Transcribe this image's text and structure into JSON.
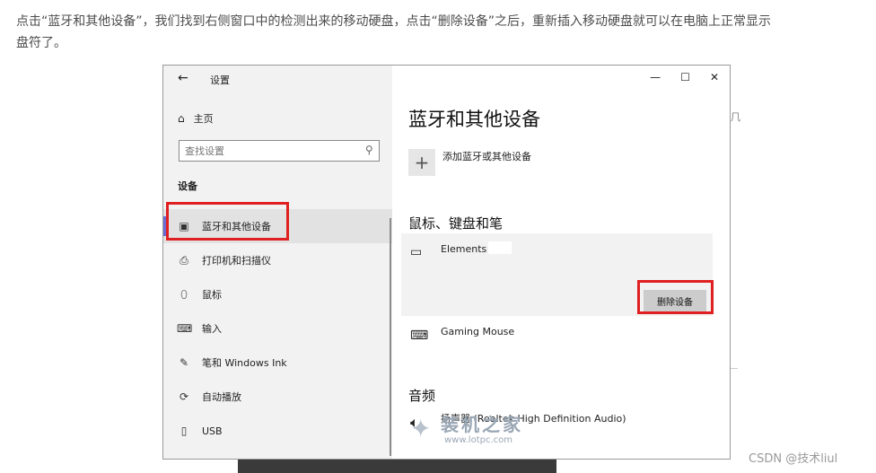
{
  "article": {
    "line1": "点击“蓝牙和其他设备”，我们找到右侧窗口中的检测出来的移动硬盘，点击“删除设备”之后，重新插入移动硬盘就可以在电脑上正常显示",
    "line2": "盘符了。"
  },
  "window": {
    "back_glyph": "←",
    "title": "设置",
    "controls": {
      "minimize": "—",
      "maximize": "☐",
      "close": "✕"
    }
  },
  "sidebar": {
    "home_label": "主页",
    "search_placeholder": "查找设置",
    "section_label": "设备",
    "items": [
      {
        "label": "蓝牙和其他设备",
        "icon": "bluetooth-devices-icon",
        "glyph": "▣",
        "active": true
      },
      {
        "label": "打印机和扫描仪",
        "icon": "printer-icon",
        "glyph": "⎙",
        "active": false
      },
      {
        "label": "鼠标",
        "icon": "mouse-icon",
        "glyph": "⬯",
        "active": false
      },
      {
        "label": "输入",
        "icon": "keyboard-icon",
        "glyph": "⌨",
        "active": false
      },
      {
        "label": "笔和 Windows Ink",
        "icon": "pen-icon",
        "glyph": "✎",
        "active": false
      },
      {
        "label": "自动播放",
        "icon": "autoplay-icon",
        "glyph": "⟳",
        "active": false
      },
      {
        "label": "USB",
        "icon": "usb-icon",
        "glyph": "▯",
        "active": false
      }
    ]
  },
  "main": {
    "heading": "蓝牙和其他设备",
    "add_device_label": "添加蓝牙或其他设备",
    "add_glyph": "+",
    "mouse_keyboard_heading": "鼠标、键盘和笔",
    "devices": [
      {
        "name": "Elements .",
        "icon": "drive-icon",
        "glyph": "▭"
      },
      {
        "name": "Gaming Mouse",
        "icon": "keyboard-device-icon",
        "glyph": "⌨"
      }
    ],
    "remove_button": "删除设备",
    "audio_heading": "音频",
    "audio_device": "扬声器 (Realtek High Definition Audio)",
    "speaker_glyph": "🔈︎"
  },
  "watermark": {
    "big": "装机之家",
    "small": "www.lotpc.com"
  },
  "csdn_tag": "CSDN @技术liul",
  "colors": {
    "highlight": "#e02020",
    "active_indicator": "#6b6bd4",
    "sidebar_bg": "#f2f2f2"
  }
}
